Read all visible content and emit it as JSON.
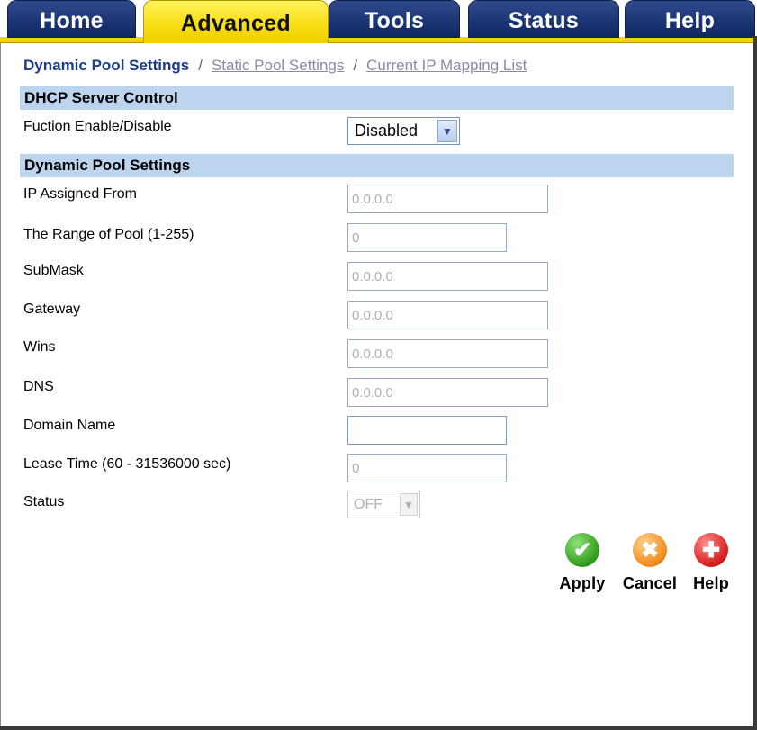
{
  "tabs": [
    {
      "label": "Home",
      "active": false
    },
    {
      "label": "Advanced",
      "active": true
    },
    {
      "label": "Tools",
      "active": false
    },
    {
      "label": "Status",
      "active": false
    },
    {
      "label": "Help",
      "active": false
    }
  ],
  "breadcrumb": {
    "current": "Dynamic Pool Settings",
    "separator": "/",
    "link1": "Static Pool Settings",
    "link2": "Current IP Mapping List"
  },
  "dhcp_section": {
    "title": "DHCP Server Control",
    "function_label": "Fuction Enable/Disable",
    "function_value": "Disabled"
  },
  "pool_section": {
    "title": "Dynamic Pool Settings",
    "ip_from_label": "IP Assigned From",
    "ip_from_value": "0.0.0.0",
    "range_label": "The Range of Pool (1-255)",
    "range_value": "0",
    "submask_label": "SubMask",
    "submask_value": "0.0.0.0",
    "gateway_label": "Gateway",
    "gateway_value": "0.0.0.0",
    "wins_label": "Wins",
    "wins_value": "0.0.0.0",
    "dns_label": "DNS",
    "dns_value": "0.0.0.0",
    "domain_label": "Domain Name",
    "domain_value": "",
    "lease_label": "Lease Time (60 - 31536000 sec)",
    "lease_value": "0",
    "status_label": "Status",
    "status_value": "OFF"
  },
  "actions": {
    "apply": "Apply",
    "cancel": "Cancel",
    "help": "Help"
  },
  "colors": {
    "tab_bg": "#17306e",
    "tab_active": "#f6dc10",
    "section_bg": "#bcd4ee",
    "crumb_current": "#1a3c8c"
  }
}
